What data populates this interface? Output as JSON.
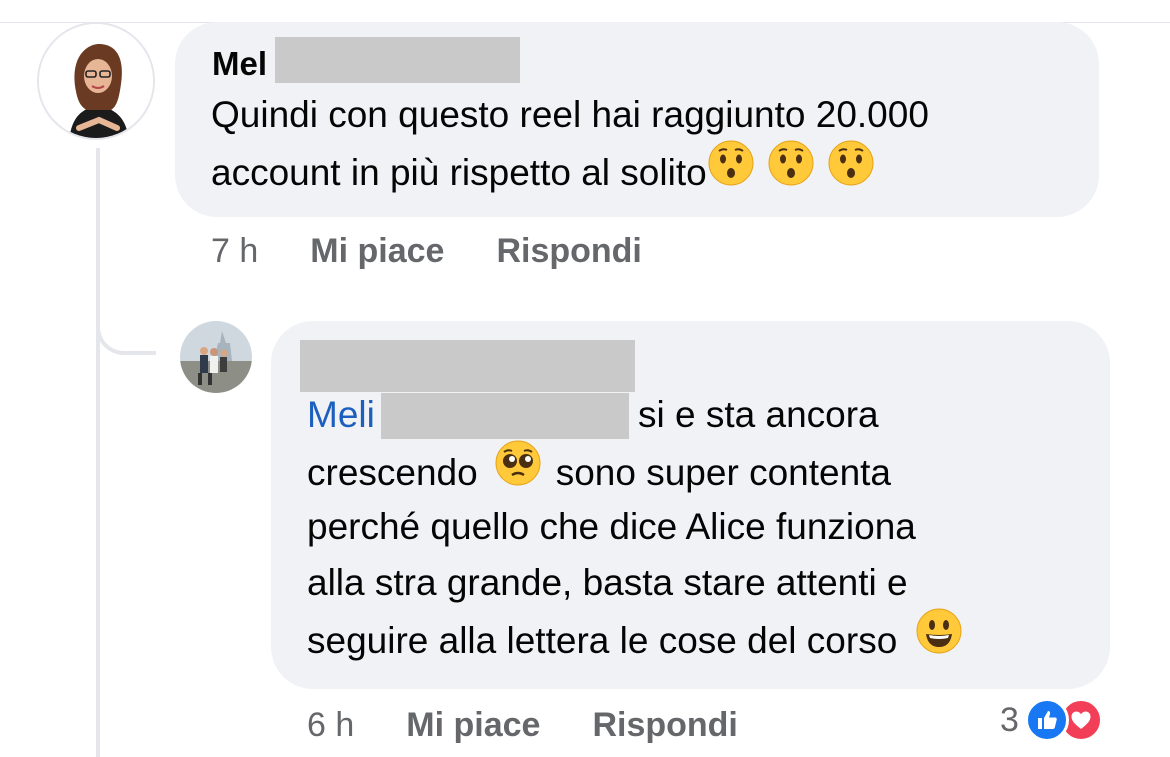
{
  "comment": {
    "author": "Mel",
    "lines": [
      "Quindi con questo reel hai raggiunto 20.000",
      "account in più rispetto al solito"
    ],
    "emojis": [
      "hushed-face-emoji",
      "hushed-face-emoji",
      "hushed-face-emoji"
    ],
    "time": "7 h",
    "like_label": "Mi piace",
    "reply_label": "Rispondi"
  },
  "reply": {
    "mention": "Meli",
    "line1_rest": "si e sta ancora",
    "line2_a": "crescendo",
    "line2_b": "sono super contenta",
    "line3": "perché quello che dice Alice funziona",
    "line4": "alla stra grande, basta stare attenti e",
    "line5": "seguire alla lettera le cose del corso",
    "emojis": [
      "pleading-face-emoji",
      "smiley-face-emoji"
    ],
    "time": "6 h",
    "like_label": "Mi piace",
    "reply_label": "Rispondi",
    "reaction_count": "3",
    "reactions": [
      "like-icon",
      "love-icon"
    ]
  },
  "colors": {
    "bubble": "#f0f2f5",
    "mention": "#1d5fbf",
    "meta": "#65676b",
    "like": "#1877f2",
    "love": "#f33e58"
  }
}
